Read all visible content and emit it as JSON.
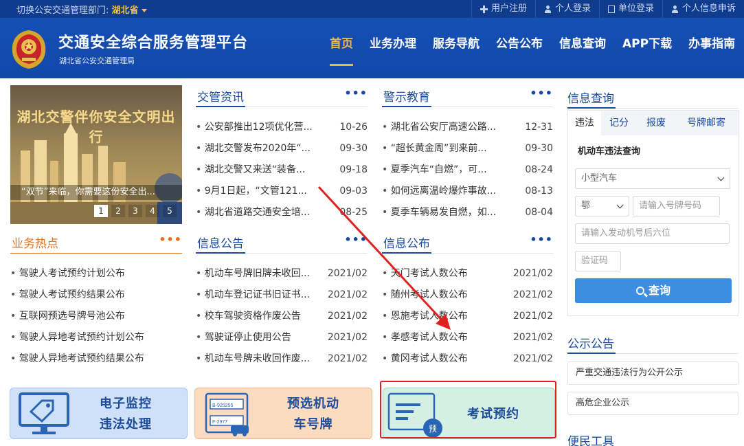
{
  "topbar": {
    "switch_prefix": "切换公安交通管理部门: ",
    "switch_value": "湖北省",
    "links": [
      "用户注册",
      "个人登录",
      "单位登录",
      "个人信息申诉"
    ]
  },
  "header": {
    "title": "交通安全综合服务管理平台",
    "subtitle": "湖北省公安交通管理局",
    "nav": [
      "首页",
      "业务办理",
      "服务导航",
      "公告公布",
      "信息查询",
      "APP下载",
      "办事指南"
    ],
    "active_nav": 0,
    "accent": "#f3b34b"
  },
  "banner": {
    "title": "湖北交警伴你安全文明出行",
    "caption": "“双节”来临，你需要这份安全出...",
    "pages": [
      "1",
      "2",
      "3",
      "4",
      "5"
    ],
    "current_page": 1
  },
  "panels": {
    "news": {
      "title": "交管资讯",
      "more": "•••",
      "items": [
        {
          "text": "公安部推出12项优化营...",
          "date": "10-26"
        },
        {
          "text": "湖北交警发布2020年“...",
          "date": "09-30"
        },
        {
          "text": "湖北交警又来送“装备...",
          "date": "09-18"
        },
        {
          "text": "9月1日起，“文管121...",
          "date": "09-03"
        },
        {
          "text": "湖北省道路交通安全培...",
          "date": "08-25"
        }
      ]
    },
    "warning": {
      "title": "警示教育",
      "more": "•••",
      "items": [
        {
          "text": "湖北省公安厅高速公路...",
          "date": "12-31"
        },
        {
          "text": "“超长黄金周”到来前...",
          "date": "09-30"
        },
        {
          "text": "夏季汽车“自燃”，可...",
          "date": "08-24"
        },
        {
          "text": "如何远离温岭爆炸事故...",
          "date": "08-13"
        },
        {
          "text": "夏季车辆易发自燃，如...",
          "date": "08-04"
        }
      ]
    },
    "hot": {
      "title": "业务热点",
      "more": "•••",
      "items": [
        {
          "text": "驾驶人考试预约计划公布"
        },
        {
          "text": "驾驶人考试预约结果公布"
        },
        {
          "text": "互联网预选号牌号池公布"
        },
        {
          "text": "驾驶人异地考试预约计划公布"
        },
        {
          "text": "驾驶人异地考试预约结果公布"
        }
      ]
    },
    "announce": {
      "title": "信息公告",
      "more": "•••",
      "items": [
        {
          "text": "机动车号牌旧牌未收回...",
          "date": "2021/02"
        },
        {
          "text": "机动车登记证书旧证书...",
          "date": "2021/02"
        },
        {
          "text": "校车驾驶资格作废公告",
          "date": "2021/02"
        },
        {
          "text": "驾驶证停止使用公告",
          "date": "2021/02"
        },
        {
          "text": "机动车号牌未收回作废...",
          "date": "2021/02"
        }
      ]
    },
    "publish": {
      "title": "信息公布",
      "more": "•••",
      "items": [
        {
          "text": "天门考试人数公布",
          "date": "2021/02"
        },
        {
          "text": "随州考试人数公布",
          "date": "2021/02"
        },
        {
          "text": "恩施考试人数公布",
          "date": "2021/02"
        },
        {
          "text": "孝感考试人数公布",
          "date": "2021/02"
        },
        {
          "text": "黄冈考试人数公布",
          "date": "2021/02"
        }
      ]
    }
  },
  "tiles": {
    "monitor": {
      "line1": "电子监控",
      "line2": "违法处理"
    },
    "plate": {
      "line1": "预选机动",
      "line2": "车号牌",
      "plate_a": "B-925255",
      "plate_b": "F-2977"
    },
    "exam": {
      "label": "考试预约",
      "badge": "预"
    }
  },
  "query": {
    "title": "信息查询",
    "tabs": [
      "违法",
      "记分",
      "报废",
      "号牌邮寄"
    ],
    "active_tab": 0,
    "subtitle": "机动车违法查询",
    "vehicle_type": "小型汽车",
    "province": "鄂",
    "plate_placeholder": "请输入号牌号码",
    "engine_placeholder": "请输入发动机号后六位",
    "captcha_placeholder": "验证码",
    "button": "查询"
  },
  "notices": {
    "title": "公示公告",
    "items": [
      "严重交通违法行为公开公示",
      "高危企业公示"
    ]
  },
  "tools": {
    "title": "便民工具"
  },
  "colors": {
    "header_blue": "#1550b5",
    "topbar_blue": "#103c8e",
    "link_blue": "#1a4aa0",
    "orange": "#e8721a",
    "button_blue": "#3d8de3",
    "annotation_red": "#e02020"
  }
}
